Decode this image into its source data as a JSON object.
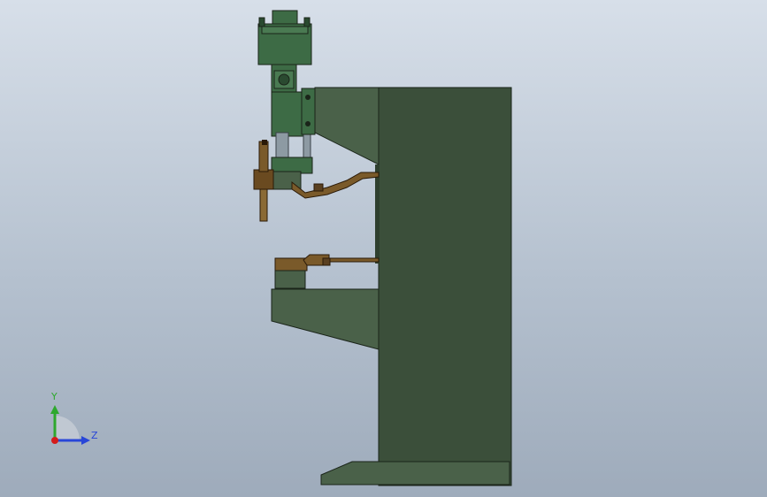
{
  "viewport": {
    "background_top": "#d7dfe9",
    "background_bottom": "#9eabbb"
  },
  "model": {
    "description_colors": {
      "frame_face": "#3b4f3a",
      "frame_side": "#4a6149",
      "frame_edge": "#1a2419",
      "cylinder": "#3d6b45",
      "arm_copper": "#7a5a2a",
      "electrode": "#8a6a35"
    }
  },
  "triad": {
    "y_label": "Y",
    "z_label": "Z",
    "y_color": "#2ea82e",
    "z_color": "#2846d8",
    "x_color": "#d41c1c"
  }
}
